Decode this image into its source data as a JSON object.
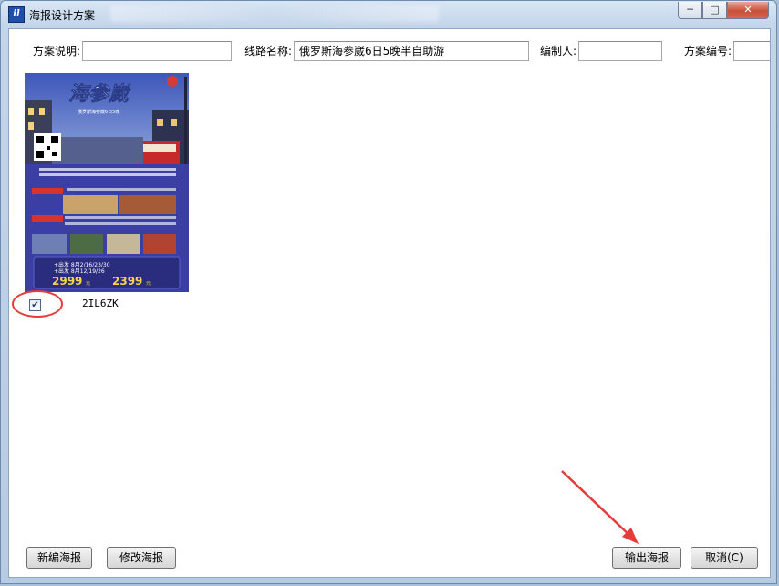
{
  "window": {
    "title": "海报设计方案",
    "app_icon_text": "il",
    "min_glyph": "─",
    "max_glyph": "□",
    "close_glyph": "✕"
  },
  "form": {
    "scheme_desc_label": "方案说明:",
    "scheme_desc_value": "",
    "route_label": "线路名称:",
    "route_value": "俄罗斯海参崴6日5晚半自助游",
    "editor_label": "编制人:",
    "editor_value": "",
    "scheme_no_label": "方案编号:",
    "scheme_no_value": ""
  },
  "poster": {
    "title": "海参崴",
    "subtitle": "俄罗斯海参崴6日5晚",
    "date_line_1": "+出发 8月2/16/23/30",
    "date_line_2": "+出发 8月12/19/26",
    "price_1": "2999",
    "price_2": "2399",
    "price_unit": "元",
    "code": "2IL6ZK",
    "checked": true,
    "check_glyph": "✔"
  },
  "buttons": {
    "new_poster": "新编海报",
    "edit_poster": "修改海报",
    "export_poster": "输出海报",
    "cancel": "取消(C)"
  }
}
